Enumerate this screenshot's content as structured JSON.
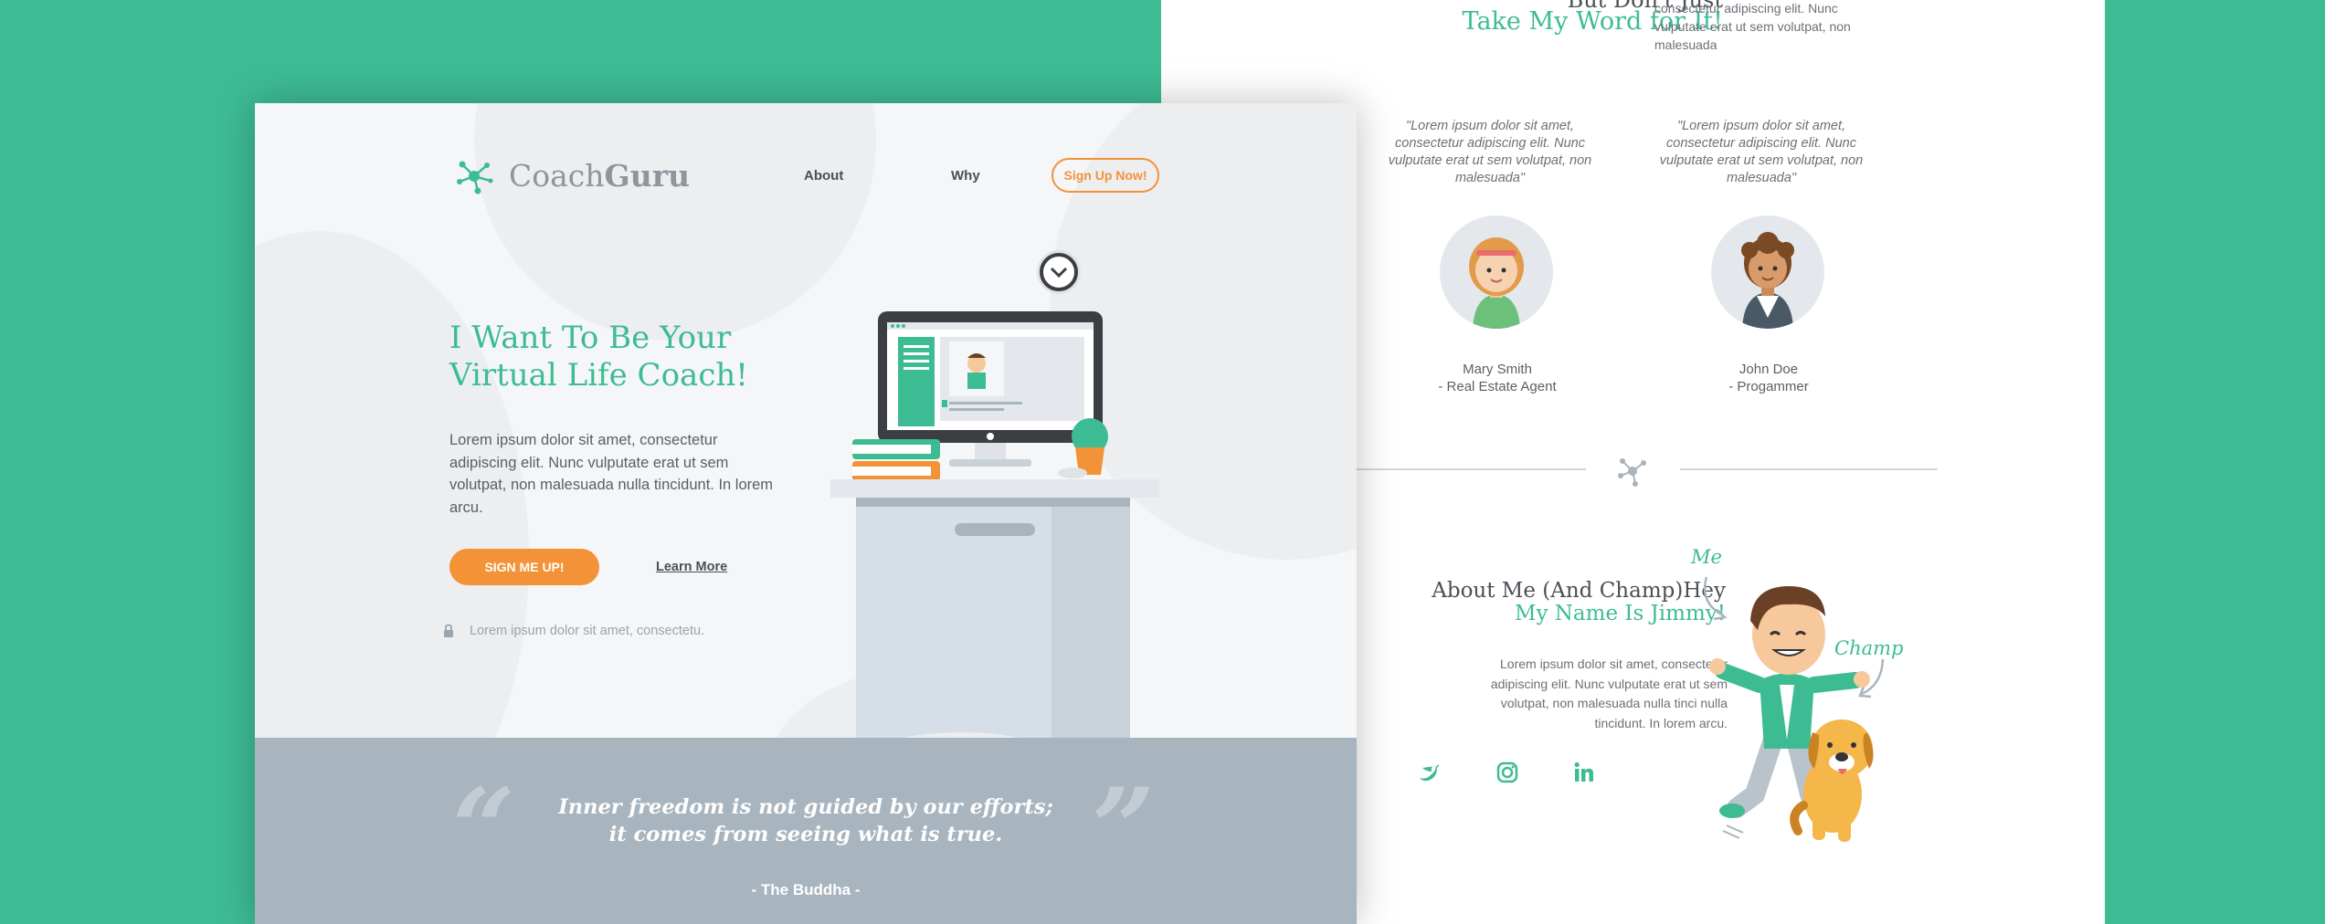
{
  "back": {
    "heading_top": "But Don't Just",
    "heading_green": "Take My Word for It!",
    "intro_text": "consectetur adipiscing elit. Nunc vulputate erat ut sem volutpat, non malesuada",
    "testimonials": [
      {
        "quote": "\"Lorem ipsum dolor sit amet, consectetur adipiscing elit. Nunc vulputate erat ut sem volutpat, non malesuada\"",
        "name": "Mary Smith",
        "role": "- Real Estate Agent"
      },
      {
        "quote": "\"Lorem ipsum dolor sit amet, consectetur adipiscing elit. Nunc vulputate erat ut sem volutpat, non malesuada\"",
        "name": "John Doe",
        "role": "- Progammer"
      }
    ],
    "about_heading_dark": "About Me (And Champ)Hey",
    "about_heading_green": "My Name Is Jimmy!",
    "about_text": "Lorem ipsum dolor sit amet, consectetur adipiscing elit. Nunc vulputate erat ut sem volutpat, non malesuada nulla tinci nulla tincidunt. In lorem arcu.",
    "label_me": "Me",
    "label_champ": "Champ",
    "social_icons": [
      "facebook-icon",
      "twitter-icon",
      "instagram-icon",
      "linkedin-icon"
    ]
  },
  "front": {
    "logo_light": "Coach",
    "logo_bold": "Guru",
    "nav": {
      "about": "About",
      "why": "Why",
      "signup": "Sign Up Now!"
    },
    "hero_title_1": "I Want To Be Your",
    "hero_title_2": "Virtual Life Coach!",
    "hero_text": "Lorem ipsum dolor sit amet, consectetur adipiscing elit. Nunc vulputate erat ut sem volutpat, non malesuada nulla tincidunt. In lorem arcu.",
    "cta": "SIGN ME UP!",
    "learn_more": "Learn More",
    "secure_note": "Lorem ipsum dolor sit amet, consectetu.",
    "quote_line_1": "Inner freedom is not guided by our efforts;",
    "quote_line_2": "it comes from seeing what is true.",
    "quote_author": "- The Buddha -"
  },
  "colors": {
    "background": "#3dbc93",
    "accent_green": "#3dbc93",
    "accent_orange": "#f39237",
    "quote_band": "#a8b5bf"
  }
}
